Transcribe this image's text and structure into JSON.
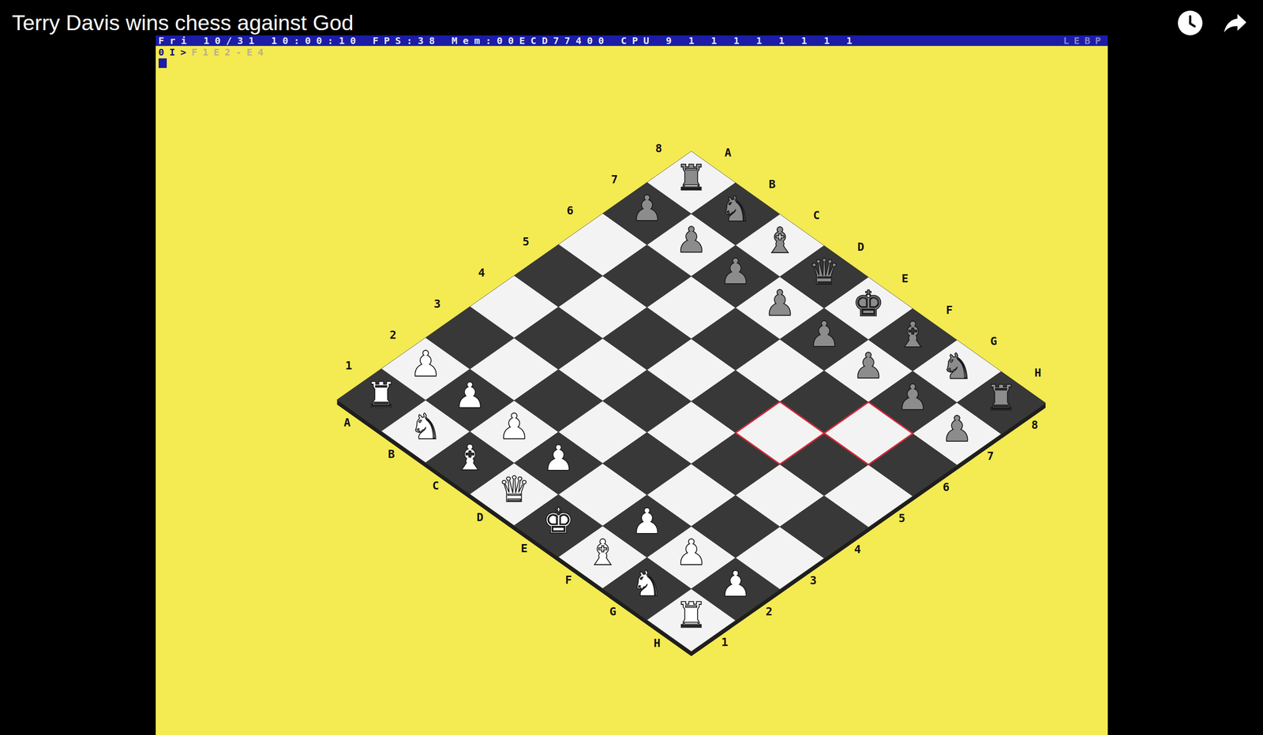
{
  "video": {
    "title": "Terry Davis wins chess against God"
  },
  "status_bar": {
    "text": "Fri 10/31 10:00:10 FPS:38 Mem:00ECD77400 CPU 9 1 1 1 1 1 1 1 1",
    "right": "LEBP"
  },
  "prompt": {
    "text": "0I>",
    "input": "F1E2-E4"
  },
  "board": {
    "files": [
      "A",
      "B",
      "C",
      "D",
      "E",
      "F",
      "G",
      "H"
    ],
    "ranks": [
      "1",
      "2",
      "3",
      "4",
      "5",
      "6",
      "7",
      "8"
    ],
    "highlighted": [
      "f5",
      "g6"
    ],
    "pieces": [
      {
        "square": "a1",
        "glyph": "♜",
        "side": "white",
        "color": "#ffffff"
      },
      {
        "square": "b1",
        "glyph": "♞",
        "side": "white",
        "color": "#ffffff"
      },
      {
        "square": "c1",
        "glyph": "♝",
        "side": "white",
        "color": "#ffffff"
      },
      {
        "square": "d1",
        "glyph": "♛",
        "side": "white",
        "color": "#ffffff"
      },
      {
        "square": "e1",
        "glyph": "♚",
        "side": "white",
        "color": "#ffffff"
      },
      {
        "square": "f1",
        "glyph": "♝",
        "side": "white",
        "color": "#ffffff"
      },
      {
        "square": "g1",
        "glyph": "♞",
        "side": "white",
        "color": "#ffffff"
      },
      {
        "square": "h1",
        "glyph": "♜",
        "side": "white",
        "color": "#ffffff"
      },
      {
        "square": "a2",
        "glyph": "♟",
        "side": "white",
        "color": "#ffffff"
      },
      {
        "square": "b2",
        "glyph": "♟",
        "side": "white",
        "color": "#ffffff"
      },
      {
        "square": "c2",
        "glyph": "♟",
        "side": "white",
        "color": "#ffffff"
      },
      {
        "square": "d2",
        "glyph": "♟",
        "side": "white",
        "color": "#ffffff"
      },
      {
        "square": "f2",
        "glyph": "♟",
        "side": "white",
        "color": "#ffffff"
      },
      {
        "square": "g2",
        "glyph": "♟",
        "side": "white",
        "color": "#ffffff"
      },
      {
        "square": "h2",
        "glyph": "♟",
        "side": "white",
        "color": "#ffffff"
      },
      {
        "square": "a8",
        "glyph": "♜",
        "side": "black",
        "color": "#8c8c8c"
      },
      {
        "square": "b8",
        "glyph": "♞",
        "side": "black",
        "color": "#8c8c8c"
      },
      {
        "square": "c8",
        "glyph": "♝",
        "side": "black",
        "color": "#8c8c8c"
      },
      {
        "square": "d8",
        "glyph": "♛",
        "side": "black",
        "color": "#8c8c8c"
      },
      {
        "square": "e8",
        "glyph": "♚",
        "side": "black",
        "color": "#8c8c8c"
      },
      {
        "square": "f8",
        "glyph": "♝",
        "side": "black",
        "color": "#8c8c8c"
      },
      {
        "square": "g8",
        "glyph": "♞",
        "side": "black",
        "color": "#8c8c8c"
      },
      {
        "square": "h8",
        "glyph": "♜",
        "side": "black",
        "color": "#8c8c8c"
      },
      {
        "square": "a7",
        "glyph": "♟",
        "side": "black",
        "color": "#8c8c8c"
      },
      {
        "square": "b7",
        "glyph": "♟",
        "side": "black",
        "color": "#8c8c8c"
      },
      {
        "square": "c7",
        "glyph": "♟",
        "side": "black",
        "color": "#8c8c8c"
      },
      {
        "square": "d7",
        "glyph": "♟",
        "side": "black",
        "color": "#8c8c8c"
      },
      {
        "square": "e7",
        "glyph": "♟",
        "side": "black",
        "color": "#8c8c8c"
      },
      {
        "square": "f7",
        "glyph": "♟",
        "side": "black",
        "color": "#8c8c8c"
      },
      {
        "square": "g7",
        "glyph": "♟",
        "side": "black",
        "color": "#8c8c8c"
      },
      {
        "square": "h7",
        "glyph": "♟",
        "side": "black",
        "color": "#8c8c8c"
      }
    ]
  }
}
